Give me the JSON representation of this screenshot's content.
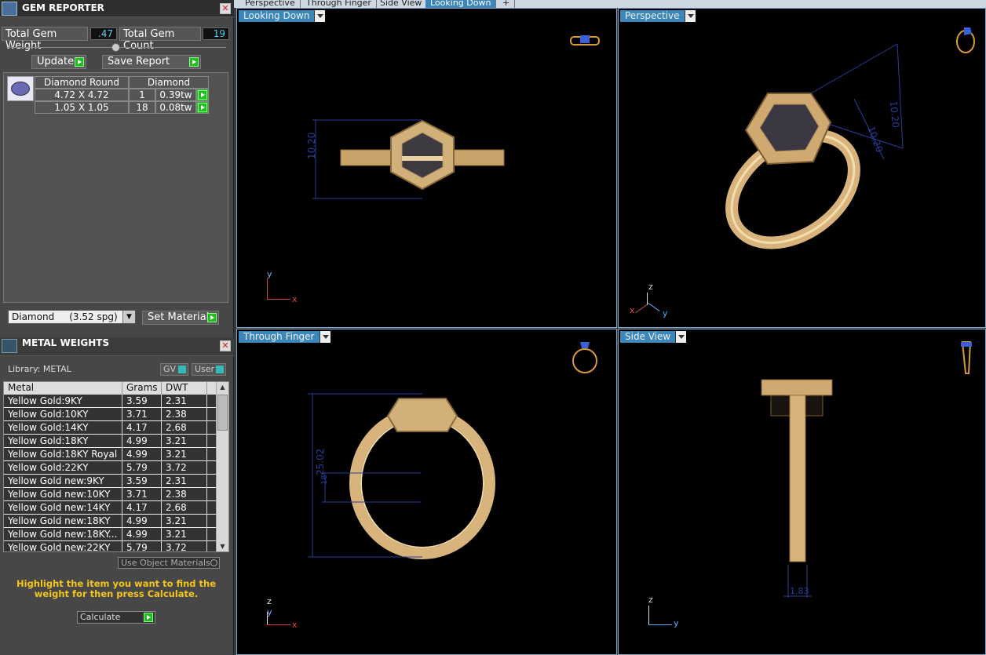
{
  "gem_reporter": {
    "title": "GEM REPORTER",
    "total_weight_label": "Total Gem Weight",
    "total_weight_value": ".47",
    "total_count_label": "Total Gem Count",
    "total_count_value": "19",
    "update_label": "Update",
    "save_report_label": "Save Report",
    "gem_headers": [
      "Diamond Round",
      "Diamond"
    ],
    "gems": [
      {
        "size": "4.72 X 4.72",
        "count": "1",
        "weight": "0.39tw"
      },
      {
        "size": "1.05 X 1.05",
        "count": "18",
        "weight": "0.08tw"
      }
    ],
    "material_select": "Diamond     (3.52 spg)",
    "set_material_label": "Set Material"
  },
  "metal_weights": {
    "title": "METAL WEIGHTS",
    "library_label": "Library: METAL",
    "gv_label": "GV",
    "user_label": "User",
    "headers": [
      "Metal",
      "Grams",
      "DWT"
    ],
    "rows": [
      [
        "Yellow Gold:9KY",
        "3.59",
        "2.31"
      ],
      [
        "Yellow Gold:10KY",
        "3.71",
        "2.38"
      ],
      [
        "Yellow Gold:14KY",
        "4.17",
        "2.68"
      ],
      [
        "Yellow Gold:18KY",
        "4.99",
        "3.21"
      ],
      [
        "Yellow Gold:18KY Royal",
        "4.99",
        "3.21"
      ],
      [
        "Yellow Gold:22KY",
        "5.79",
        "3.72"
      ],
      [
        "Yellow Gold new:9KY",
        "3.59",
        "2.31"
      ],
      [
        "Yellow Gold new:10KY",
        "3.71",
        "2.38"
      ],
      [
        "Yellow Gold new:14KY",
        "4.17",
        "2.68"
      ],
      [
        "Yellow Gold new:18KY",
        "4.99",
        "3.21"
      ],
      [
        "Yellow Gold new:18KY...",
        "4.99",
        "3.21"
      ],
      [
        "Yellow Gold new:22KY",
        "5.79",
        "3.72"
      ]
    ],
    "use_object_label": "Use Object Materials",
    "hint": "Highlight the item you want to find the weight for then press Calculate.",
    "calculate_label": "Calculate"
  },
  "tabs": [
    "Perspective",
    "Through Finger",
    "Side View",
    "Looking Down",
    "+"
  ],
  "viewports": {
    "looking_down": {
      "label": "Looking Down",
      "dim": "10.20"
    },
    "perspective": {
      "label": "Perspective",
      "dim1": "10.20",
      "dim2": "10.20"
    },
    "through_finger": {
      "label": "Through Finger",
      "dim1": "25.02",
      "dim2": "18"
    },
    "side_view": {
      "label": "Side View",
      "dim": "1.83"
    }
  },
  "axes": {
    "x": "x",
    "y": "y",
    "z": "z"
  },
  "colors": {
    "gold": "#d8b47c",
    "dim": "#2b3c9c",
    "tab": "#3b87b9",
    "hint": "#f5c518"
  }
}
